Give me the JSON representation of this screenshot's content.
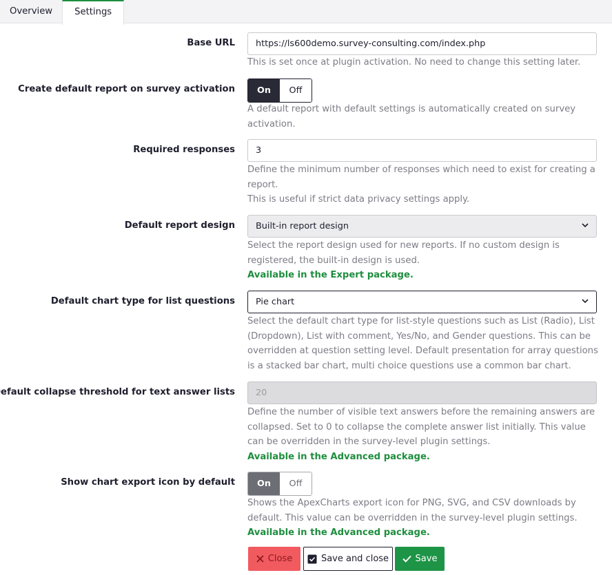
{
  "tabs": [
    {
      "label": "Overview",
      "active": false
    },
    {
      "label": "Settings",
      "active": true
    }
  ],
  "base_url": {
    "label": "Base URL",
    "value": "https://ls600demo.survey-consulting.com/index.php",
    "help": "This is set once at plugin activation. No need to change this setting later."
  },
  "create_default_report": {
    "label": "Create default report on survey activation",
    "on_label": "On",
    "off_label": "Off",
    "selected": "On",
    "help": "A default report with default settings is automatically created on survey activation."
  },
  "required_responses": {
    "label": "Required responses",
    "value": "3",
    "help1": "Define the minimum number of responses which need to exist for creating a report.",
    "help2": "This is useful if strict data privacy settings apply."
  },
  "default_report_design": {
    "label": "Default report design",
    "value": "Built-in report design",
    "help": "Select the report design used for new reports. If no custom design is registered, the built-in design is used.",
    "note": "Available in the Expert package."
  },
  "default_chart_type": {
    "label": "Default chart type for list questions",
    "value": "Pie chart",
    "help": "Select the default chart type for list-style questions such as List (Radio), List (Dropdown), List with comment, Yes/No, and Gender questions. This can be overridden at question setting level. Default presentation for array questions is a stacked bar chart, multi choice questions use a common bar chart."
  },
  "collapse_threshold": {
    "label": "Default collapse threshold for text answer lists",
    "value": "20",
    "help": "Define the number of visible text answers before the remaining answers are collapsed. Set to 0 to collapse the complete answer list initially. This value can be overridden in the survey-level plugin settings.",
    "note": "Available in the Advanced package."
  },
  "chart_export_icon": {
    "label": "Show chart export icon by default",
    "on_label": "On",
    "off_label": "Off",
    "selected": "On",
    "help": "Shows the ApexCharts export icon for PNG, SVG, and CSV downloads by default. This value can be overridden in the survey-level plugin settings.",
    "note": "Available in the Advanced package."
  },
  "buttons": {
    "close": "Close",
    "save_and_close": "Save and close",
    "save": "Save"
  },
  "colors": {
    "primary_dark": "#2a2a36",
    "success_green": "#1e8e3e",
    "danger_red": "#f15a5f",
    "help_text": "#7c7c86"
  }
}
